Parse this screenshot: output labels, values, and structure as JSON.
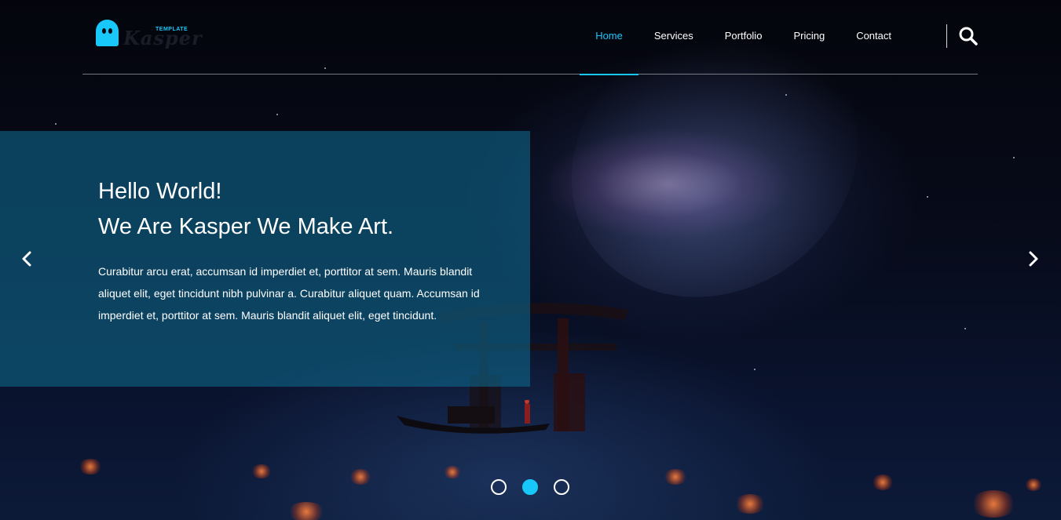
{
  "brand": {
    "name": "Kasper",
    "tag": "TEMPLATE",
    "accent": "#19c8fa"
  },
  "nav": {
    "items": [
      {
        "label": "Home",
        "active": true
      },
      {
        "label": "Services",
        "active": false
      },
      {
        "label": "Portfolio",
        "active": false
      },
      {
        "label": "Pricing",
        "active": false
      },
      {
        "label": "Contact",
        "active": false
      }
    ],
    "search_icon": "search-icon"
  },
  "hero": {
    "heading_line1": "Hello World!",
    "heading_line2": "We Are Kasper We Make Art.",
    "paragraph": "Curabitur arcu erat, accumsan id imperdiet et, porttitor at sem. Mauris blandit aliquet elit, eget tincidunt nibh pulvinar a. Curabitur aliquet quam. Accumsan id imperdiet et, porttitor at sem. Mauris blandit aliquet elit, eget tincidunt.",
    "panel_color": "#0f6487"
  },
  "slider": {
    "prev_icon": "chevron-left-icon",
    "next_icon": "chevron-right-icon",
    "slide_count": 3,
    "active_slide": 2
  }
}
